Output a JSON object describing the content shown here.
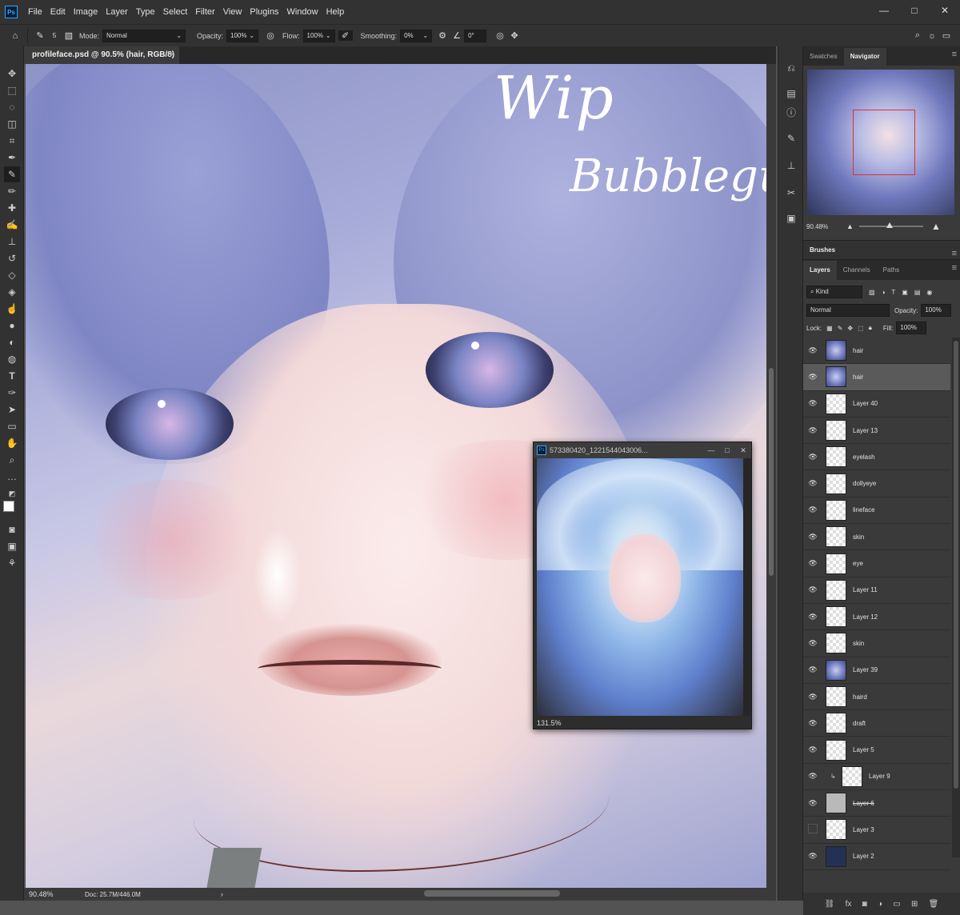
{
  "app": {
    "logo": "Ps"
  },
  "menu": [
    "File",
    "Edit",
    "Image",
    "Layer",
    "Type",
    "Select",
    "Filter",
    "View",
    "Plugins",
    "Window",
    "Help"
  ],
  "window_controls": [
    "—",
    "□",
    "✕"
  ],
  "options": {
    "brush_size": "5",
    "mode_label": "Mode:",
    "mode_value": "Normal",
    "opacity_label": "Opacity:",
    "opacity_value": "100%",
    "flow_label": "Flow:",
    "flow_value": "100%",
    "smoothing_label": "Smoothing:",
    "smoothing_value": "0%",
    "angle_value": "0°"
  },
  "document": {
    "tab_title": "profileface.psd @ 90.5% (hair, RGB/8) *",
    "tab_close": "×",
    "canvas_text_1": "Wip",
    "canvas_text_2": "Bubblegumm"
  },
  "status": {
    "zoom": "90.48%",
    "doc": "Doc: 25.7M/446.0M"
  },
  "panels": {
    "top_tabs": [
      "Swatches",
      "Navigator"
    ],
    "navigator_zoom": "90.48%",
    "brushes_title": "Brushes",
    "layers_tabs": [
      "Layers",
      "Channels",
      "Paths"
    ],
    "filter_kind": "Kind",
    "blend_mode": "Normal",
    "opacity_label": "Opacity:",
    "opacity_value": "100%",
    "lock_label": "Lock:",
    "fill_label": "Fill:",
    "fill_value": "100%"
  },
  "layers": [
    {
      "name": "hair",
      "visible": true,
      "thumb": "art",
      "selected": false
    },
    {
      "name": "hair",
      "visible": true,
      "thumb": "art",
      "selected": true
    },
    {
      "name": "Layer 40",
      "visible": true,
      "thumb": "check",
      "selected": false
    },
    {
      "name": "Layer 13",
      "visible": true,
      "thumb": "check",
      "selected": false
    },
    {
      "name": "eyelash",
      "visible": true,
      "thumb": "check",
      "selected": false
    },
    {
      "name": "dollyeye",
      "visible": true,
      "thumb": "check",
      "selected": false
    },
    {
      "name": "lineface",
      "visible": true,
      "thumb": "check",
      "selected": false
    },
    {
      "name": "skin",
      "visible": true,
      "thumb": "check",
      "selected": false
    },
    {
      "name": "eye",
      "visible": true,
      "thumb": "check",
      "selected": false
    },
    {
      "name": "Layer 11",
      "visible": true,
      "thumb": "check",
      "selected": false
    },
    {
      "name": "Layer 12",
      "visible": true,
      "thumb": "check",
      "selected": false
    },
    {
      "name": "skin",
      "visible": true,
      "thumb": "check",
      "selected": false
    },
    {
      "name": "Layer 39",
      "visible": true,
      "thumb": "art",
      "selected": false
    },
    {
      "name": "haird",
      "visible": true,
      "thumb": "check",
      "selected": false
    },
    {
      "name": "draft",
      "visible": true,
      "thumb": "check",
      "selected": false
    },
    {
      "name": "Layer 5",
      "visible": true,
      "thumb": "check",
      "selected": false
    },
    {
      "name": "Layer 9",
      "visible": true,
      "thumb": "check",
      "selected": false,
      "clipped": true
    },
    {
      "name": "Layer 6",
      "visible": true,
      "thumb": "grey",
      "selected": false,
      "strike": true
    },
    {
      "name": "Layer 3",
      "visible": false,
      "thumb": "check",
      "selected": false
    },
    {
      "name": "Layer 2",
      "visible": true,
      "thumb": "navy",
      "selected": false
    }
  ],
  "float_window": {
    "title": "573380420_1221544043006...",
    "zoom": "131.5%"
  },
  "icons": {
    "home": "home-icon",
    "brush": "brush-icon",
    "eye": "eye-icon",
    "search": "search-icon",
    "gear": "gear-icon",
    "link": "link-icon",
    "fx": "fx-icon",
    "mask": "mask-icon",
    "adjust": "adjustment-icon",
    "folder": "folder-icon",
    "new": "new-layer-icon",
    "trash": "trash-icon"
  }
}
